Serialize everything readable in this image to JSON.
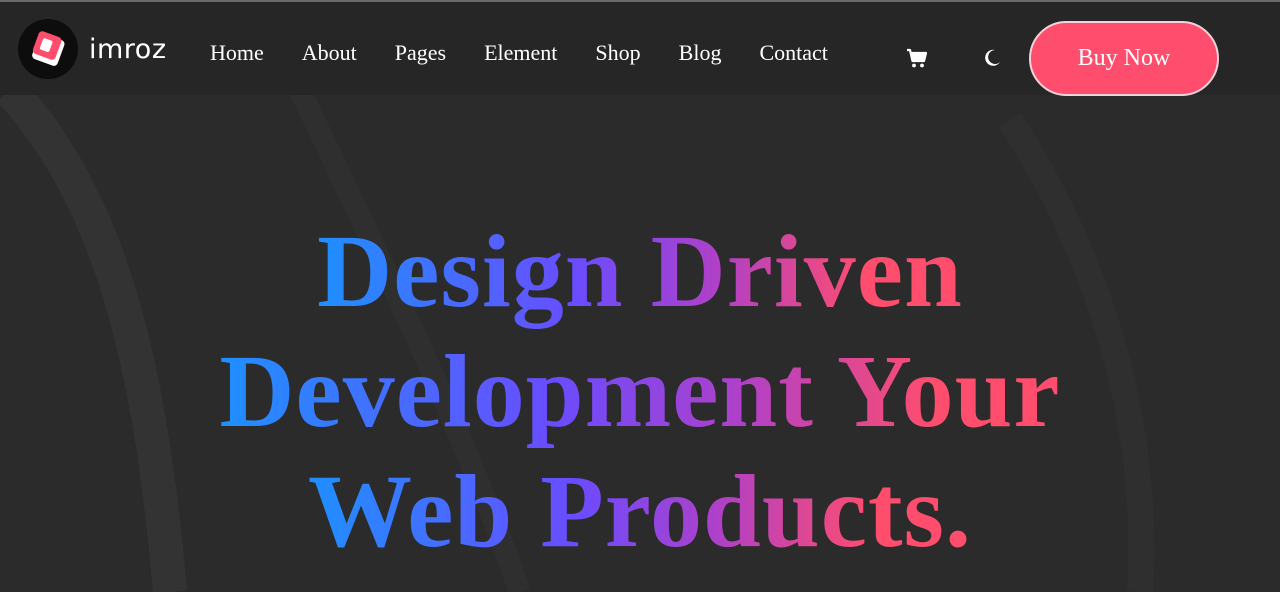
{
  "brand": {
    "name": "imroz",
    "accent_color": "#ff4d6d"
  },
  "nav": {
    "items": [
      {
        "label": "Home"
      },
      {
        "label": "About"
      },
      {
        "label": "Pages"
      },
      {
        "label": "Element"
      },
      {
        "label": "Shop"
      },
      {
        "label": "Blog"
      },
      {
        "label": "Contact"
      }
    ]
  },
  "icons": {
    "cart": "cart-icon",
    "theme_toggle": "moon-icon"
  },
  "header": {
    "cta_label": "Buy Now"
  },
  "hero": {
    "line1": "Design Driven",
    "line2": "Development Your",
    "line3": "Web Products.",
    "gradient_colors": [
      "#1e90ff",
      "#6a4cff",
      "#b040c8",
      "#ff4d6d"
    ]
  },
  "colors": {
    "background": "#2b2b2b",
    "header_background": "#262626",
    "text": "#ffffff"
  }
}
